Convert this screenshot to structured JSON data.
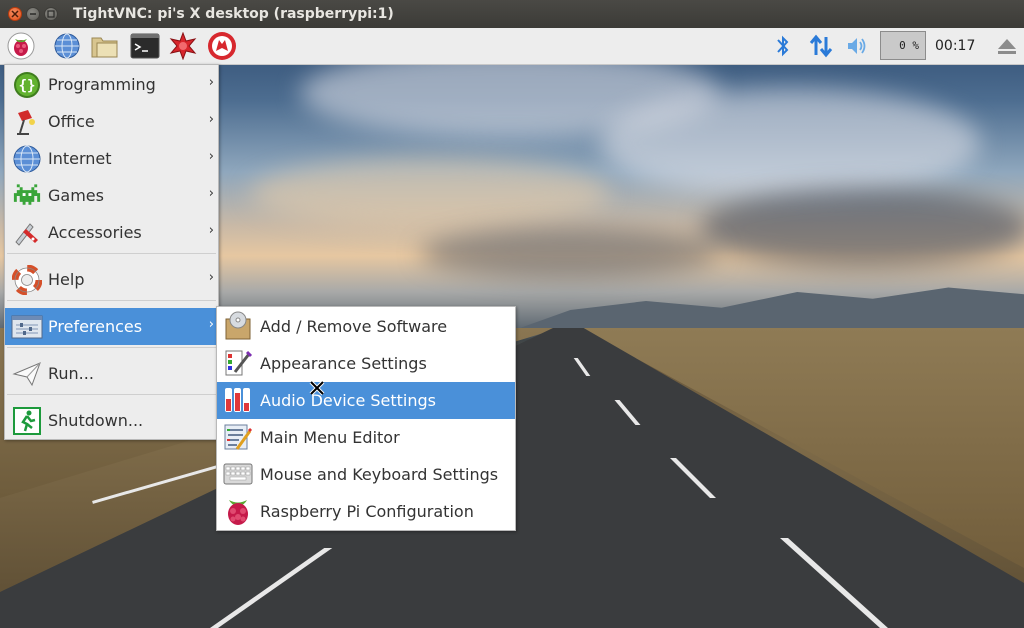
{
  "window": {
    "title": "TightVNC: pi's X desktop (raspberrypi:1)"
  },
  "panel": {
    "launchers": [
      "raspberry-menu-icon",
      "web-browser-icon",
      "file-manager-icon",
      "terminal-icon",
      "mathematica-icon",
      "wolfram-icon"
    ],
    "tray": {
      "cpu": "0 %",
      "clock": "00:17"
    }
  },
  "main_menu": {
    "items": [
      {
        "label": "Programming",
        "icon": "programming-braces-icon",
        "has_submenu": true
      },
      {
        "label": "Office",
        "icon": "office-lamp-icon",
        "has_submenu": true
      },
      {
        "label": "Internet",
        "icon": "globe-icon",
        "has_submenu": true
      },
      {
        "label": "Games",
        "icon": "space-invader-icon",
        "has_submenu": true
      },
      {
        "label": "Accessories",
        "icon": "knife-icon",
        "has_submenu": true
      },
      {
        "label": "Help",
        "icon": "lifebuoy-icon",
        "has_submenu": true
      },
      {
        "label": "Preferences",
        "icon": "preferences-icon",
        "has_submenu": true,
        "selected": true
      },
      {
        "label": "Run...",
        "icon": "paper-plane-icon",
        "has_submenu": false
      },
      {
        "label": "Shutdown...",
        "icon": "exit-running-man-icon",
        "has_submenu": false
      }
    ]
  },
  "preferences_menu": {
    "items": [
      {
        "label": "Add / Remove Software",
        "icon": "package-disc-icon"
      },
      {
        "label": "Appearance Settings",
        "icon": "appearance-palette-icon"
      },
      {
        "label": "Audio Device Settings",
        "icon": "audio-mixer-icon",
        "selected": true
      },
      {
        "label": "Main Menu Editor",
        "icon": "menu-editor-icon"
      },
      {
        "label": "Mouse and Keyboard Settings",
        "icon": "keyboard-icon"
      },
      {
        "label": "Raspberry Pi Configuration",
        "icon": "raspberry-icon"
      }
    ]
  },
  "colors": {
    "selection": "#4a90d9",
    "panel": "#ededed",
    "titlebar": "#3c3b37"
  }
}
